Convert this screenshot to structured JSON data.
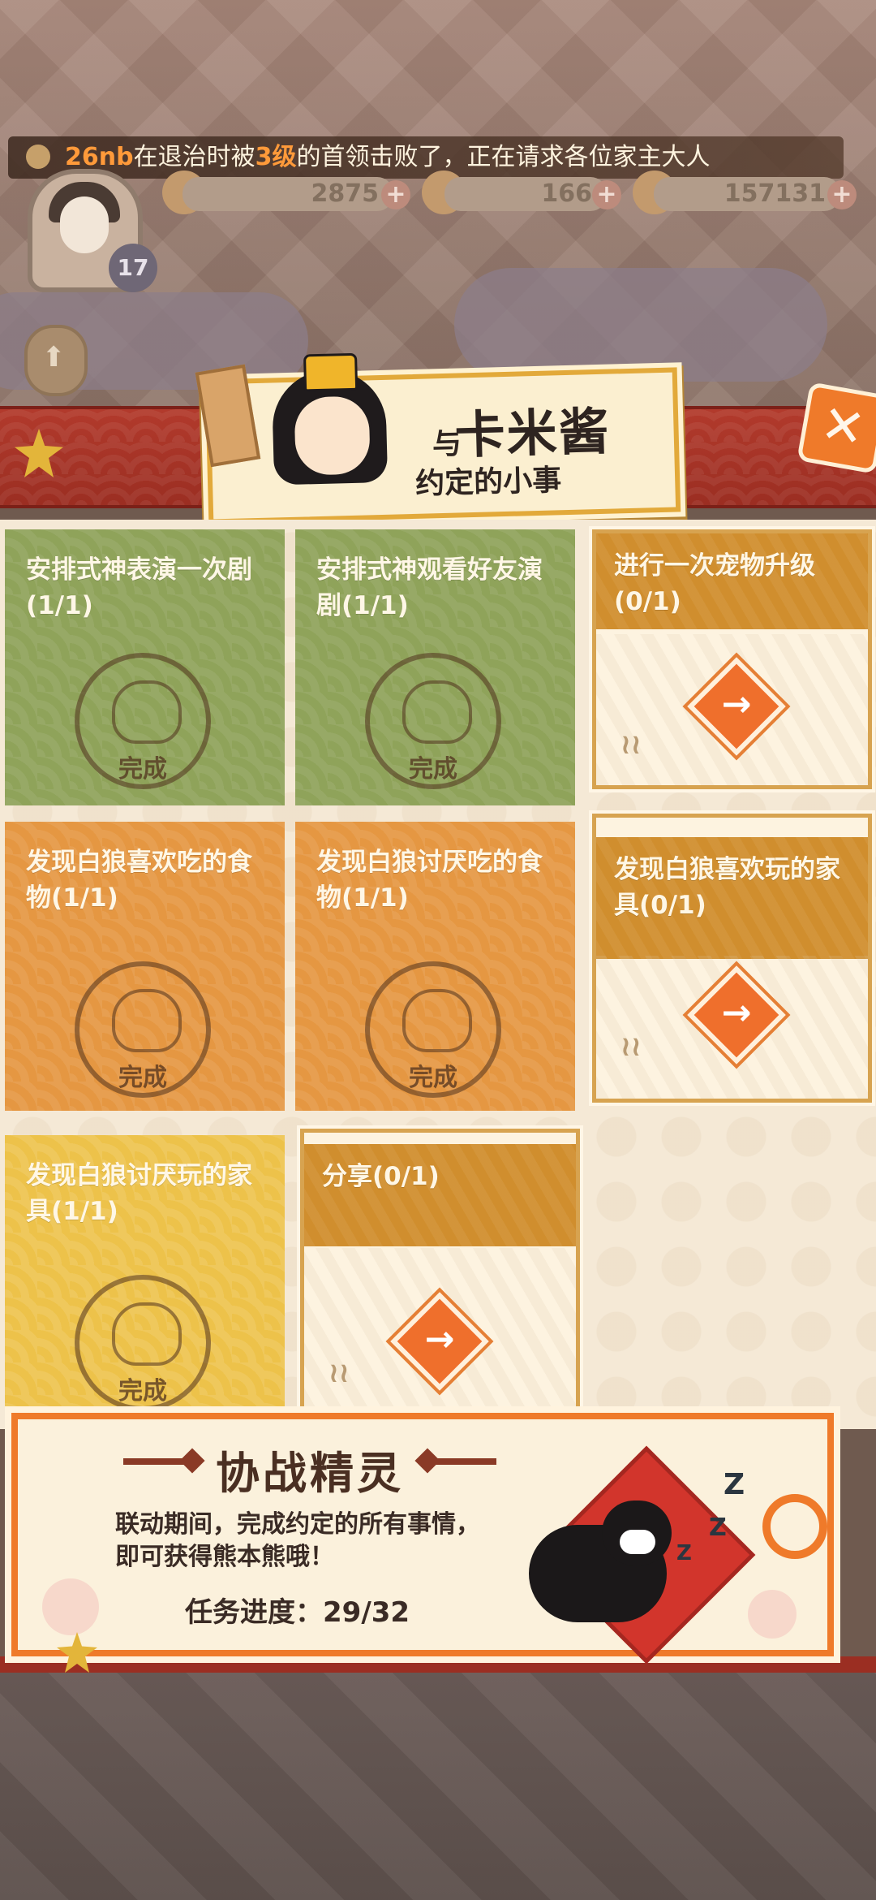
{
  "hud": {
    "ticker_segments": [
      "26nb",
      "在退治时被",
      "3级",
      "的首领击败了，正在请求各位家主大人"
    ],
    "level": "17",
    "resources": [
      "2875",
      "166",
      "157131"
    ]
  },
  "panel": {
    "title_prefix": "与",
    "title_name": "卡米酱",
    "subtitle": "约定的小事",
    "close_symbol": "✕"
  },
  "tasks": [
    {
      "text": "安排式神表演一次剧(1/1)",
      "status": "完成"
    },
    {
      "text": "安排式神观看好友演剧(1/1)",
      "status": "完成"
    },
    {
      "text": "进行一次宠物升级(0/1)",
      "action": "→"
    },
    {
      "text": "发现白狼喜欢吃的食物(1/1)",
      "status": "完成"
    },
    {
      "text": "发现白狼讨厌吃的食物(1/1)",
      "status": "完成"
    },
    {
      "text": "发现白狼喜欢玩的家具(0/1)",
      "action": "→"
    },
    {
      "text": "发现白狼讨厌玩的家具(1/1)",
      "status": "完成"
    },
    {
      "text": "分享(0/1)",
      "action": "→"
    }
  ],
  "reward": {
    "title": "协战精灵",
    "description_line1": "联动期间，完成约定的所有事情，",
    "description_line2": "即可获得熊本熊哦！",
    "progress": "任务进度：29/32"
  },
  "colors": {
    "accent_orange": "#ef7a2a",
    "band_red": "#9b2e22",
    "card_green": "#8fa35a",
    "card_orange": "#e59742",
    "card_yellow": "#edc24a"
  }
}
